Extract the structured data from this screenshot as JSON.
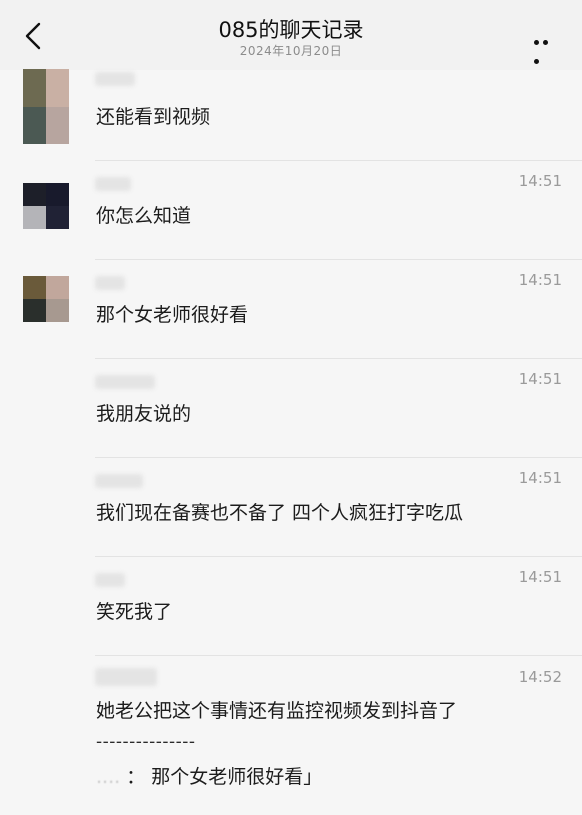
{
  "header": {
    "title": "085的聊天记录",
    "date": "2024年10月20日",
    "back_icon": "chevron-left-icon",
    "more_icon": "more-dots-icon"
  },
  "messages": [
    {
      "time": "",
      "text": "还能看到视频"
    },
    {
      "time": "14:51",
      "text": "你怎么知道"
    },
    {
      "time": "14:51",
      "text": "那个女老师很好看"
    },
    {
      "time": "14:51",
      "text": "我朋友说的"
    },
    {
      "time": "14:51",
      "text": "我们现在备赛也不备了 四个人疯狂打字吃瓜"
    },
    {
      "time": "14:51",
      "text": "笑死我了"
    },
    {
      "time": "14:52",
      "text": "她老公把这个事情还有监控视频发到抖音了",
      "separator": "---------------",
      "quote_dots": "....",
      "quote_text": "： 那个女老师很好看」"
    }
  ],
  "colors": {
    "background": "#f6f6f6",
    "header": "#f2f2f2",
    "time": "#9a9a9a",
    "divider": "#e3e3e3"
  }
}
